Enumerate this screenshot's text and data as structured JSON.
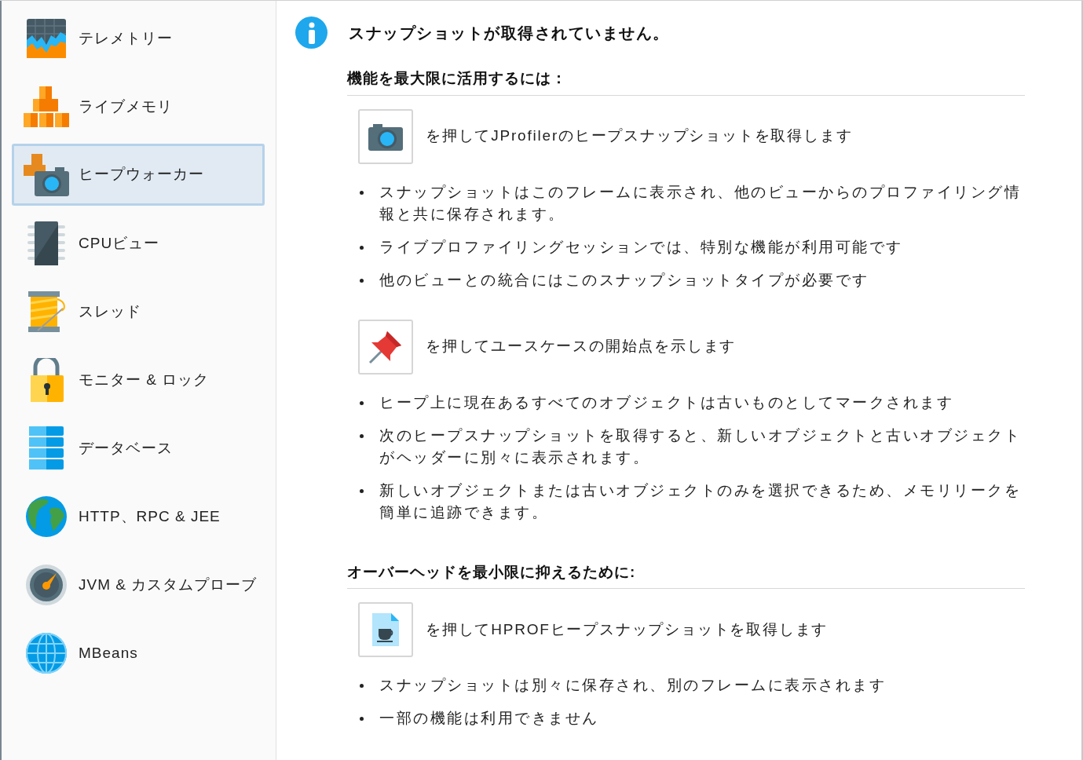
{
  "sidebar": {
    "items": [
      {
        "label": "テレメトリー",
        "selected": false
      },
      {
        "label": "ライブメモリ",
        "selected": false
      },
      {
        "label": "ヒープウォーカー",
        "selected": true
      },
      {
        "label": "CPUビュー",
        "selected": false
      },
      {
        "label": "スレッド",
        "selected": false
      },
      {
        "label": "モニター & ロック",
        "selected": false
      },
      {
        "label": "データベース",
        "selected": false
      },
      {
        "label": "HTTP、RPC & JEE",
        "selected": false
      },
      {
        "label": "JVM & カスタムプローブ",
        "selected": false
      },
      {
        "label": "MBeans",
        "selected": false
      }
    ]
  },
  "main": {
    "title": "スナップショットが取得されていません。",
    "sections": [
      {
        "heading": "機能を最大限に活用するには：",
        "actions": [
          {
            "text": "を押してJProfilerのヒープスナップショットを取得します",
            "bullets": [
              "スナップショットはこのフレームに表示され、他のビューからのプロファイリング情報と共に保存されます。",
              "ライブプロファイリングセッションでは、特別な機能が利用可能です",
              "他のビューとの統合にはこのスナップショットタイプが必要です"
            ]
          },
          {
            "text": "を押してユースケースの開始点を示します",
            "bullets": [
              "ヒープ上に現在あるすべてのオブジェクトは古いものとしてマークされます",
              "次のヒープスナップショットを取得すると、新しいオブジェクトと古いオブジェクトがヘッダーに別々に表示されます。",
              "新しいオブジェクトまたは古いオブジェクトのみを選択できるため、メモリリークを簡単に追跡できます。"
            ]
          }
        ]
      },
      {
        "heading": "オーバーヘッドを最小限に抑えるために:",
        "actions": [
          {
            "text": "を押してHPROFヒープスナップショットを取得します",
            "bullets": [
              "スナップショットは別々に保存され、別のフレームに表示されます",
              "一部の機能は利用できません"
            ]
          }
        ]
      }
    ]
  }
}
